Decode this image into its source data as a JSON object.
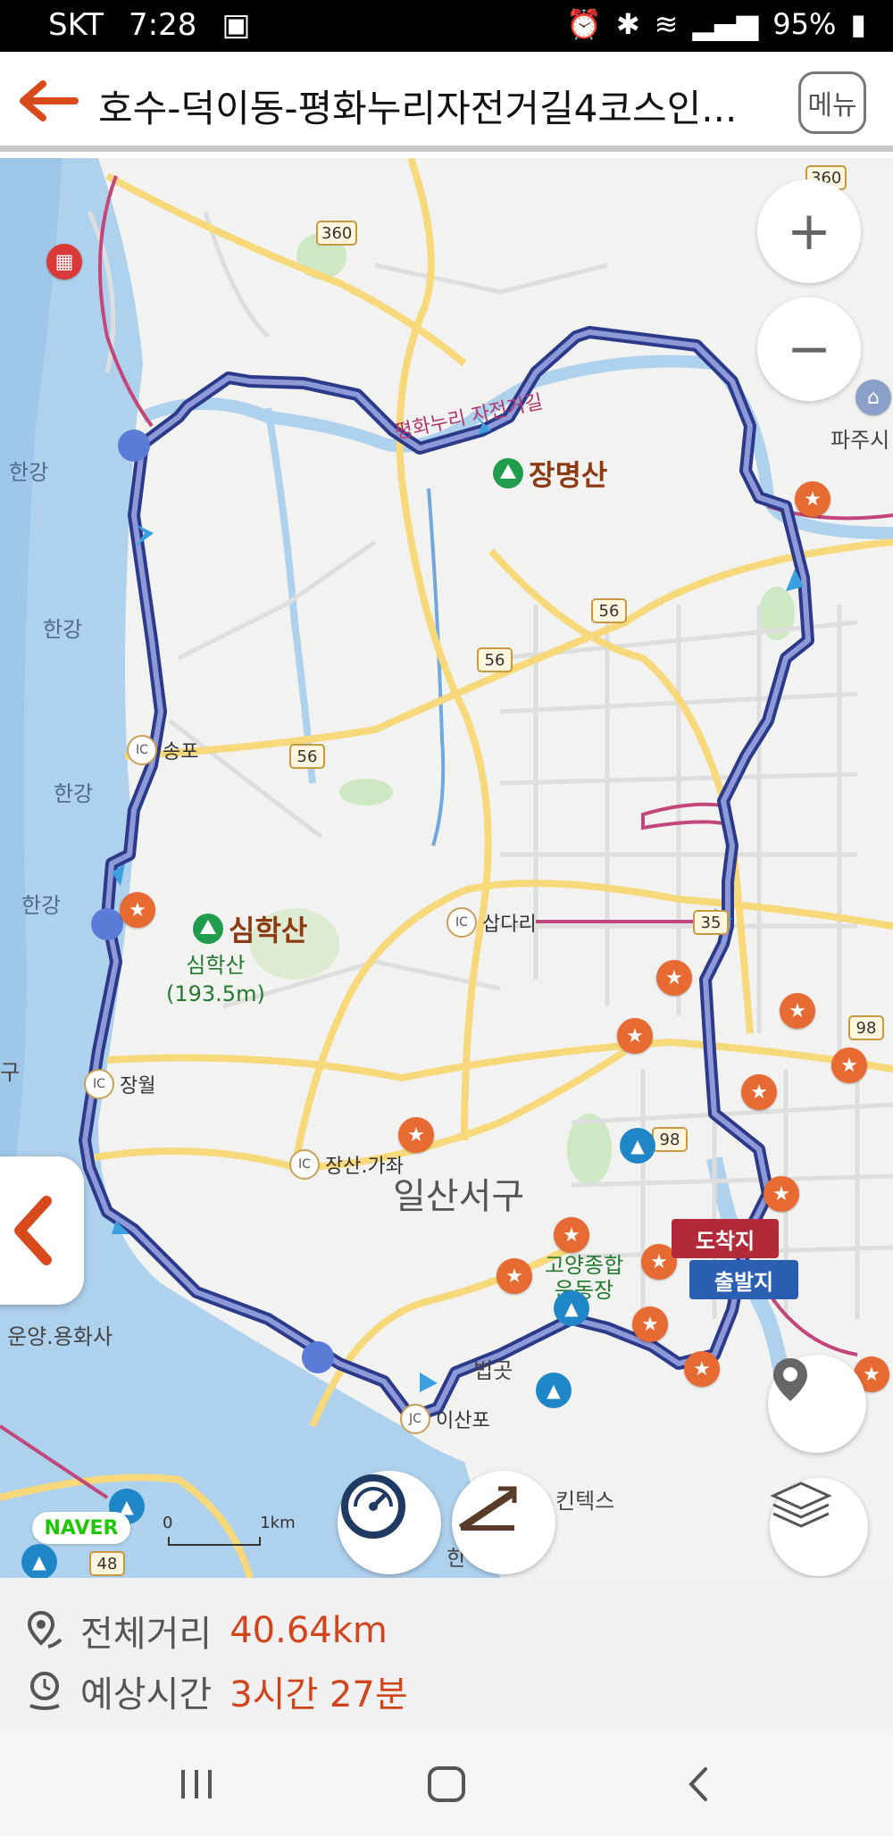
{
  "status_bar": {
    "carrier": "SKT",
    "time": "7:28",
    "battery": "95%"
  },
  "header": {
    "title": "호수-덕이동-평화누리자전거길4코스인...",
    "menu_label": "메뉴",
    "back_icon": "back-arrow-icon"
  },
  "map": {
    "water_labels": [
      "한강",
      "한강",
      "한강",
      "한강"
    ],
    "mountains": [
      {
        "name": "장명산"
      },
      {
        "name": "심학산",
        "sub": "심학산",
        "height": "(193.5m)"
      }
    ],
    "district": "일산서구",
    "ic_labels": {
      "ic1": "송포",
      "ic2": "삽다리",
      "ic3": "장월",
      "ic4": "장산.가좌",
      "jc1": "이산포"
    },
    "place_labels": {
      "bicycle_road": "평화누리 자전거길",
      "paju": "파주시",
      "yongsan": "운양.용화사",
      "beopgot": "법곳",
      "kintex": "킨텍스",
      "stadium": "고양종합운동장",
      "han_bottom": "한",
      "left_edge": "구"
    },
    "road_numbers": [
      "360",
      "360",
      "56",
      "56",
      "56",
      "98",
      "98",
      "48",
      "35"
    ],
    "ic_badge": "IC",
    "jc_badge": "JC",
    "flags": {
      "arrival": "도착지",
      "departure": "출발지"
    },
    "logo": "NAVER",
    "scale": {
      "zero": "0",
      "one": "1km"
    },
    "route_color": "#3c4fb5"
  },
  "summary": {
    "distance_label": "전체거리",
    "distance_value": "40.64km",
    "time_label": "예상시간",
    "time_value": "3시간 27분"
  }
}
